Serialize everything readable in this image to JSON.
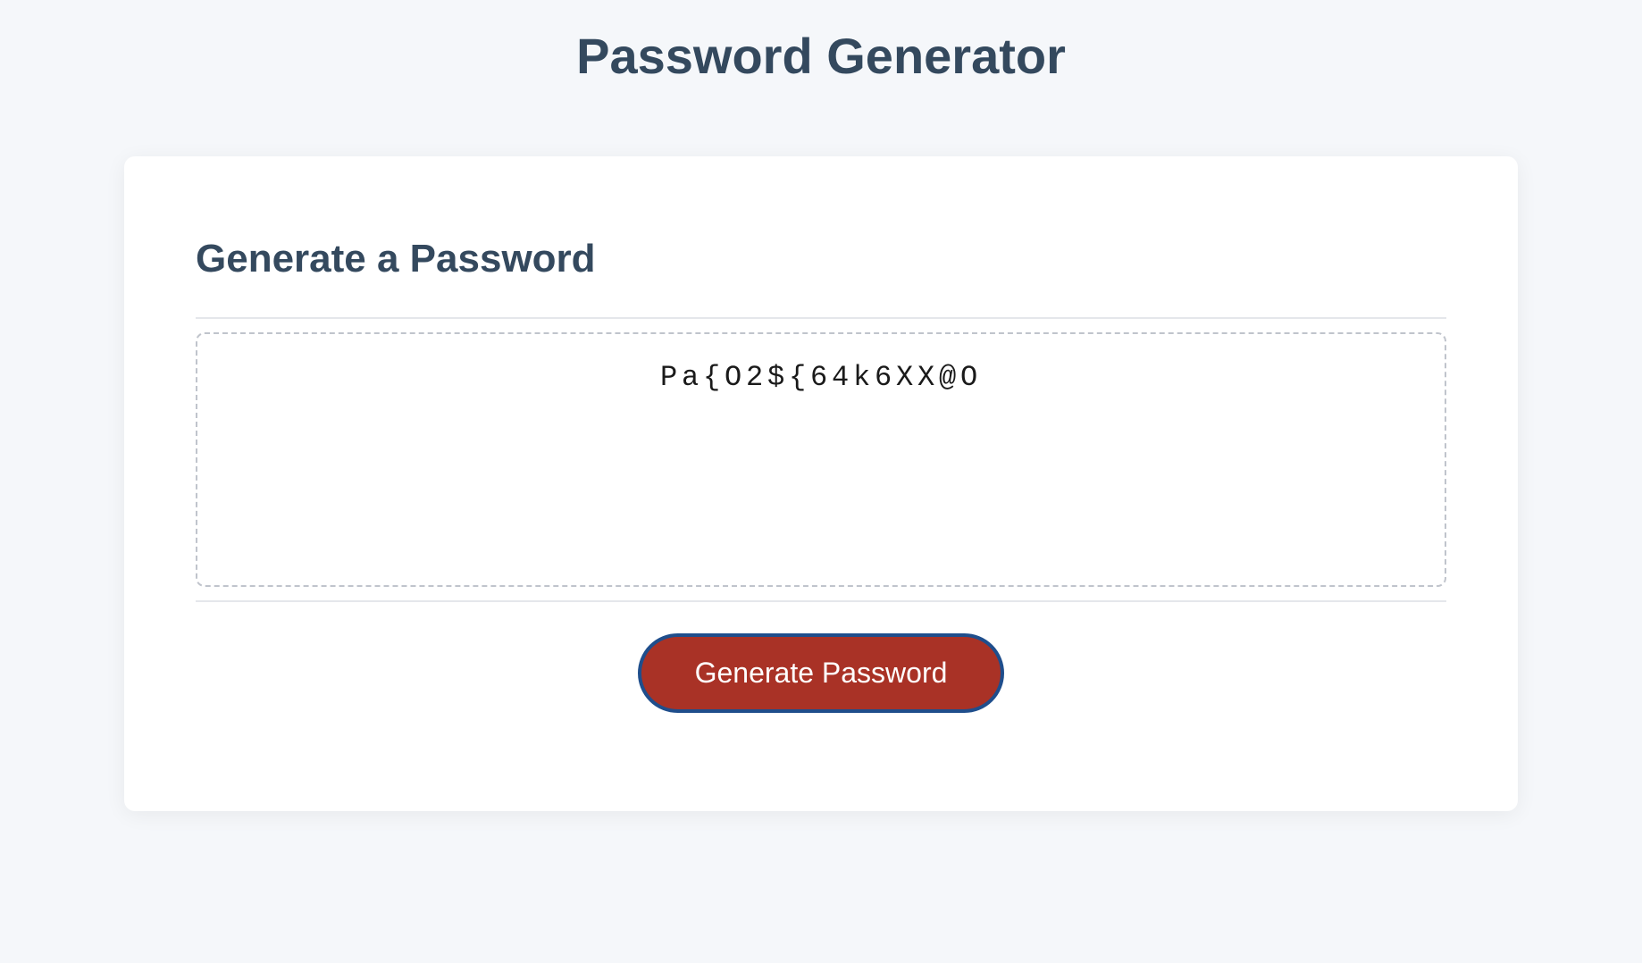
{
  "header": {
    "title": "Password Generator"
  },
  "card": {
    "title": "Generate a Password",
    "password_value": "Pa{O2${64k6XX@O",
    "button_label": "Generate Password"
  }
}
